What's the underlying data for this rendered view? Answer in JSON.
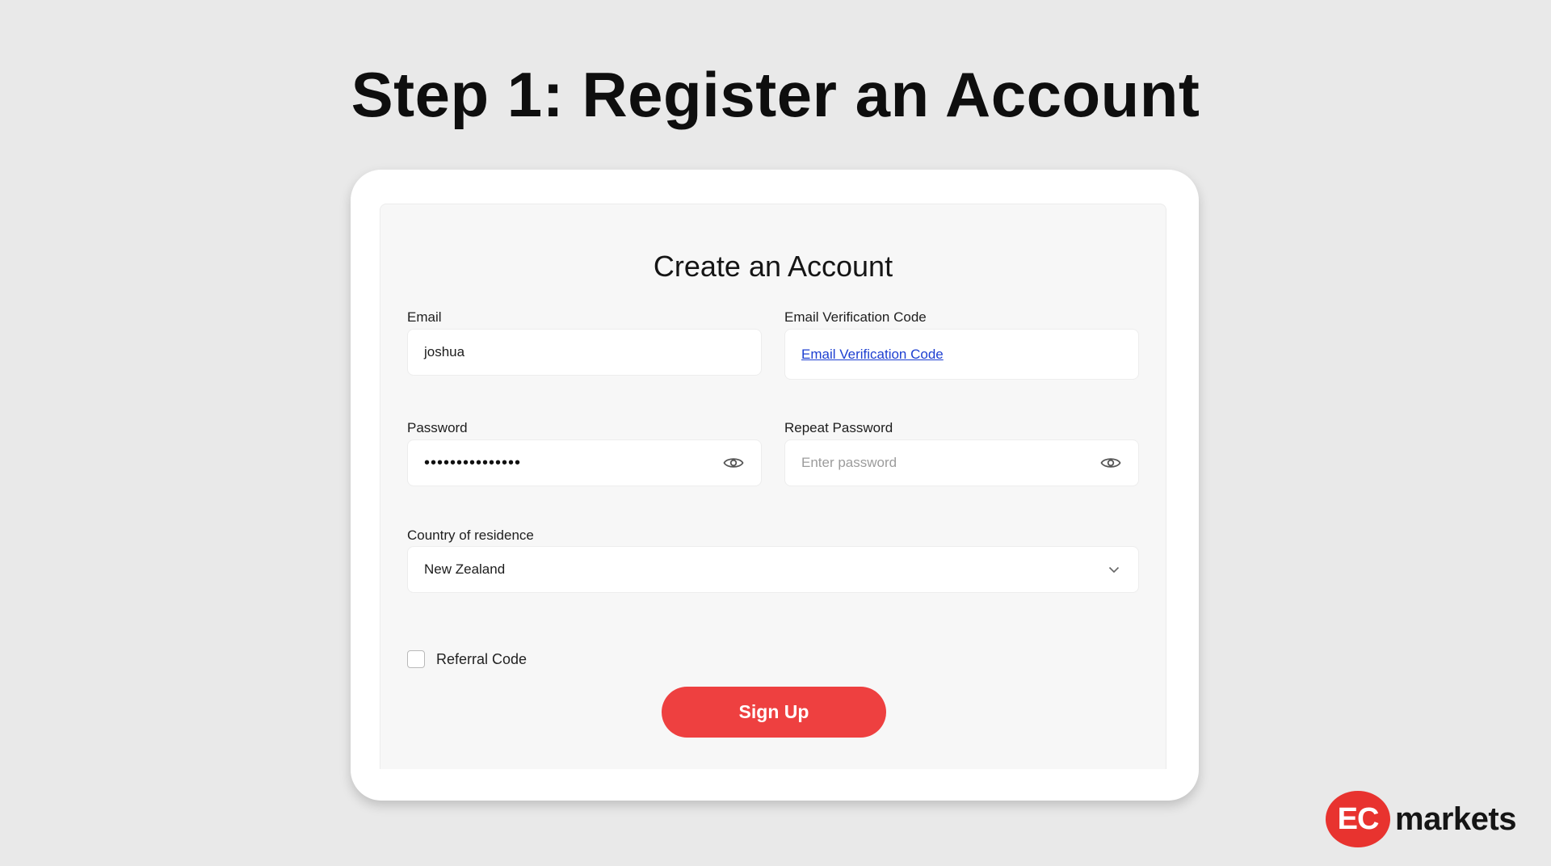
{
  "heading": "Step 1: Register an Account",
  "form": {
    "title": "Create an Account",
    "email": {
      "label": "Email",
      "value": "joshua"
    },
    "verification": {
      "label": "Email Verification Code",
      "link_text": "Email Verification Code"
    },
    "password": {
      "label": "Password",
      "masked_value": "•••••••••••••••"
    },
    "repeat_password": {
      "label": "Repeat Password",
      "placeholder": "Enter password"
    },
    "country": {
      "label": "Country of residence",
      "selected": "New Zealand"
    },
    "referral": {
      "label": "Referral Code",
      "checked": false
    },
    "submit_label": "Sign Up"
  },
  "brand": {
    "badge_text": "EC",
    "name": "markets",
    "accent_color": "#ee4040"
  },
  "icons": {
    "password_toggle": "eye-icon",
    "dropdown": "chevron-down-icon"
  }
}
